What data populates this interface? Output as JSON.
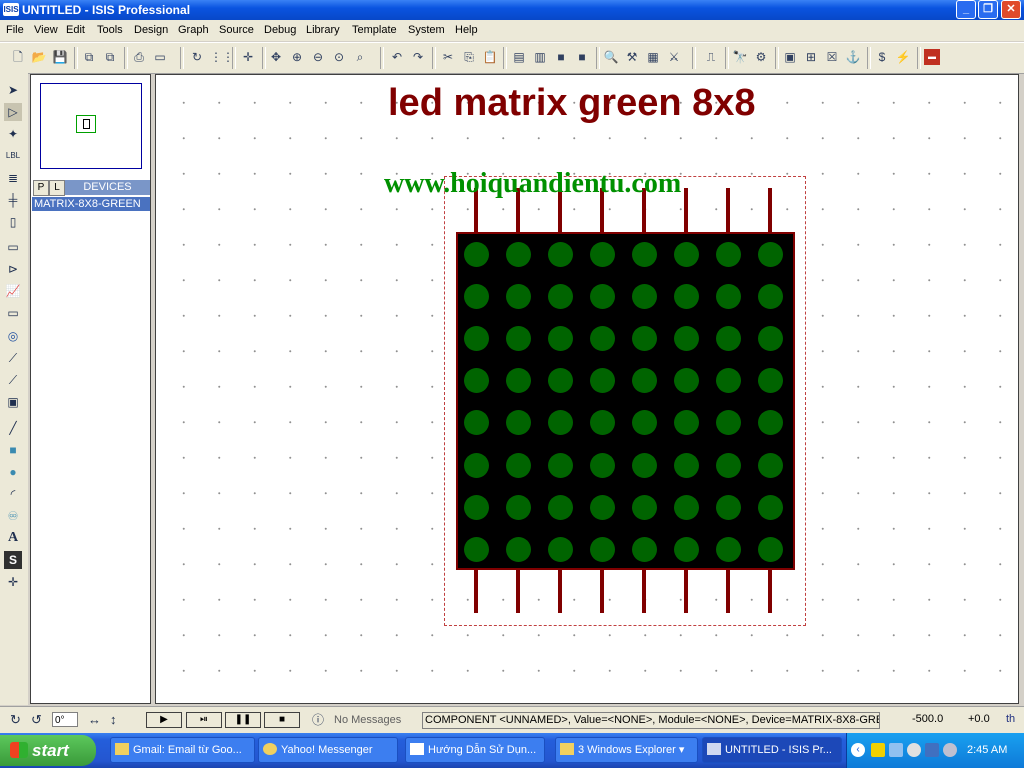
{
  "window": {
    "app_icon": "ISIS",
    "title": "UNTITLED - ISIS Professional",
    "controls": [
      "minimize-icon",
      "maximize-icon",
      "close-icon"
    ]
  },
  "menu": [
    "File",
    "View",
    "Edit",
    "Tools",
    "Design",
    "Graph",
    "Source",
    "Debug",
    "Library",
    "Template",
    "System",
    "Help"
  ],
  "side_panel": {
    "p_label": "P",
    "l_label": "L",
    "devices_header": "DEVICES",
    "devices": [
      "MATRIX-8X8-GREEN"
    ]
  },
  "canvas": {
    "title": "led matrix green 8x8",
    "url": "www.hoiquandientu.com",
    "matrix": {
      "rows": 8,
      "cols": 8,
      "led_color": "#006400",
      "body_color": "#000000",
      "pin_color": "#800000"
    }
  },
  "bottom": {
    "angle": "0°",
    "message": "No Messages",
    "status": "COMPONENT <UNNAMED>, Value=<NONE>, Module=<NONE>, Device=MATRIX-8X8-GREEI",
    "coord_x": "-500.0",
    "coord_y": "+0.0",
    "unit": "th"
  },
  "taskbar": {
    "start": "start",
    "tasks": [
      {
        "label": "Gmail: Email từ Goo..."
      },
      {
        "label": "Yahoo! Messenger"
      },
      {
        "label": "Hướng Dẫn Sử Dụn..."
      },
      {
        "label": "3 Windows Explorer"
      },
      {
        "label": "UNTITLED - ISIS Pr..."
      }
    ],
    "clock": "2:45 AM"
  }
}
